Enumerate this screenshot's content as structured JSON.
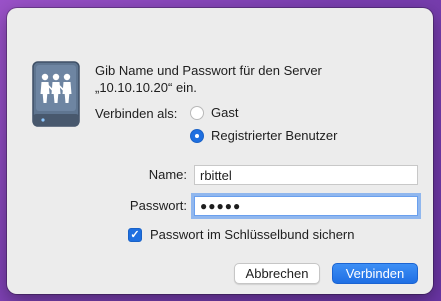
{
  "dialog": {
    "prompt": "Gib Name und Passwort für den Server „10.10.10.20“ ein.",
    "connect_as_label": "Verbinden als:",
    "options": [
      {
        "label": "Gast",
        "selected": false
      },
      {
        "label": "Registrierter Benutzer",
        "selected": true
      }
    ],
    "name_label": "Name:",
    "name_value": "rbittel",
    "password_label": "Passwort:",
    "password_value": "●●●●●",
    "keychain_label": "Passwort im Schlüsselbund sichern",
    "keychain_checked": true,
    "cancel_label": "Abbrechen",
    "connect_label": "Verbinden",
    "icon": "shared-server-icon"
  },
  "colors": {
    "accent": "#1e6fe0",
    "dialog_bg": "#ececec",
    "desktop_bg": "#7a3fb0"
  }
}
